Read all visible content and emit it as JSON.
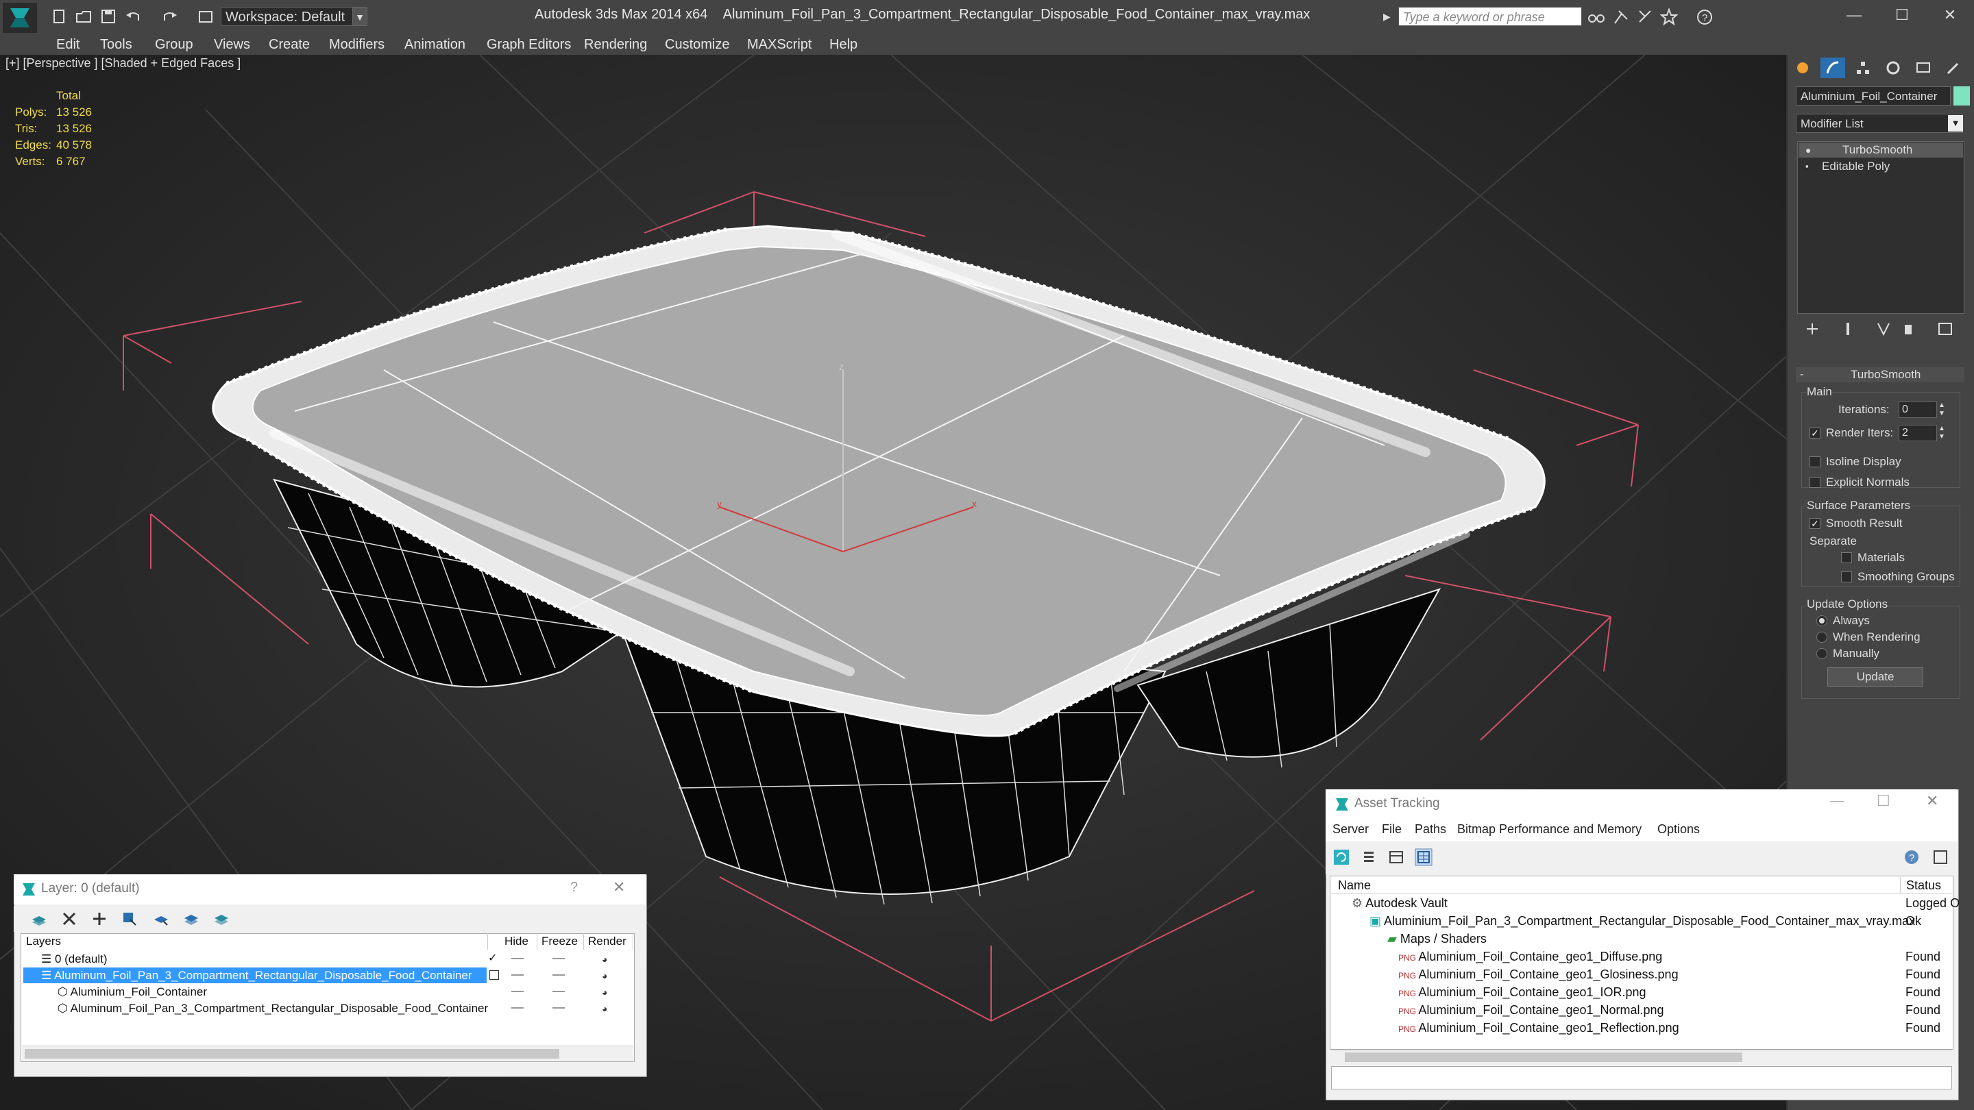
{
  "app": {
    "title": "Autodesk 3ds Max  2014 x64",
    "filename": "Aluminum_Foil_Pan_3_Compartment_Rectangular_Disposable_Food_Container_max_vray.max",
    "workspace": "Workspace: Default",
    "search_placeholder": "Type a keyword or phrase"
  },
  "menu": [
    "Edit",
    "Tools",
    "Group",
    "Views",
    "Create",
    "Modifiers",
    "Animation",
    "Graph Editors",
    "Rendering",
    "Customize",
    "MAXScript",
    "Help"
  ],
  "viewport": {
    "label": "[+] [Perspective ] [Shaded + Edged Faces ]",
    "stats_header": "Total",
    "stats": [
      {
        "label": "Polys:",
        "value": "13 526"
      },
      {
        "label": "Tris:",
        "value": "13 526"
      },
      {
        "label": "Edges:",
        "value": "40 578"
      },
      {
        "label": "Verts:",
        "value": "6 767"
      }
    ],
    "axis_z": "z",
    "axis_x": "x",
    "axis_y": "y"
  },
  "command_panel": {
    "object_name": "Aluminium_Foil_Container",
    "object_color": "#7fe3c0",
    "modifier_list": "Modifier List",
    "stack": [
      "TurboSmooth",
      "Editable Poly"
    ],
    "rollout_title": "TurboSmooth",
    "main_label": "Main",
    "iterations_label": "Iterations:",
    "iterations_value": "0",
    "render_iters_label": "Render Iters:",
    "render_iters_value": "2",
    "isoline": "Isoline Display",
    "explicit_normals": "Explicit Normals",
    "surface_params": "Surface Parameters",
    "smooth_result": "Smooth Result",
    "separate": "Separate",
    "materials": "Materials",
    "smoothing_groups": "Smoothing Groups",
    "update_options": "Update Options",
    "always": "Always",
    "when_rendering": "When Rendering",
    "manually": "Manually",
    "update_button": "Update"
  },
  "asset_tracking": {
    "title": "Asset Tracking",
    "menu": [
      "Server",
      "File",
      "Paths",
      "Bitmap Performance and Memory",
      "Options"
    ],
    "col_name": "Name",
    "col_status": "Status",
    "rows": [
      {
        "name": "Autodesk Vault",
        "status": "Logged O",
        "indent": 0
      },
      {
        "name": "Aluminium_Foil_Pan_3_Compartment_Rectangular_Disposable_Food_Container_max_vray.max",
        "status": "Ok",
        "indent": 1
      },
      {
        "name": "Maps / Shaders",
        "status": "",
        "indent": 2
      },
      {
        "name": "Aluminium_Foil_Containe_geo1_Diffuse.png",
        "status": "Found",
        "indent": 3
      },
      {
        "name": "Aluminium_Foil_Containe_geo1_Glosiness.png",
        "status": "Found",
        "indent": 3
      },
      {
        "name": "Aluminium_Foil_Containe_geo1_IOR.png",
        "status": "Found",
        "indent": 3
      },
      {
        "name": "Aluminium_Foil_Containe_geo1_Normal.png",
        "status": "Found",
        "indent": 3
      },
      {
        "name": "Aluminium_Foil_Containe_geo1_Reflection.png",
        "status": "Found",
        "indent": 3
      }
    ]
  },
  "layer_dialog": {
    "title": "Layer: 0 (default)",
    "help": "?",
    "col_layers": "Layers",
    "col_hide": "Hide",
    "col_freeze": "Freeze",
    "col_render": "Render",
    "rows": [
      {
        "name": "0 (default)",
        "indent": 0,
        "selected": false
      },
      {
        "name": "Aluminum_Foil_Pan_3_Compartment_Rectangular_Disposable_Food_Container",
        "indent": 0,
        "selected": true
      },
      {
        "name": "Aluminium_Foil_Container",
        "indent": 1,
        "selected": false
      },
      {
        "name": "Aluminum_Foil_Pan_3_Compartment_Rectangular_Disposable_Food_Container",
        "indent": 1,
        "selected": false
      }
    ]
  }
}
